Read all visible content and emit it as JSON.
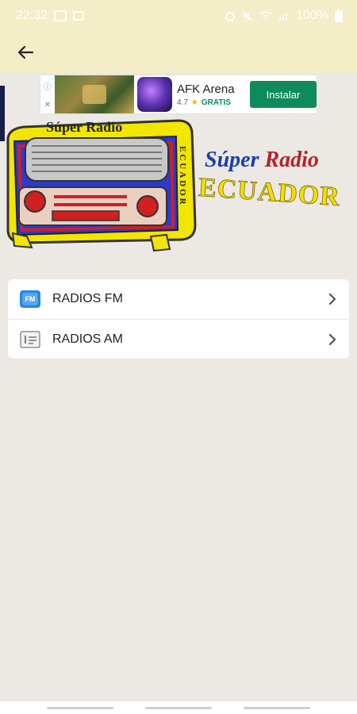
{
  "status_bar": {
    "time": "22:32",
    "battery": "100%",
    "icons": [
      "image-icon",
      "screen-icon",
      "alarm-icon",
      "mute-icon",
      "wifi-icon",
      "signal-icon",
      "battery-icon"
    ]
  },
  "app_bar": {
    "back_icon": "arrow-left-icon"
  },
  "ad": {
    "title": "AFK Arena",
    "rating": "4.7",
    "star": "★",
    "price": "GRATIS",
    "install_label": "Instalar",
    "info_icon": "ⓘ",
    "close_icon": "✕"
  },
  "logo": {
    "radio_label": "Súper Radio",
    "radio_side": "ECUADOR",
    "title_word_1": "Súper",
    "title_word_2": "Radio",
    "title_word_3": "ECUADOR"
  },
  "menu": {
    "items": [
      {
        "label": "RADIOS FM",
        "icon": "fm-radio-icon"
      },
      {
        "label": "RADIOS AM",
        "icon": "am-radio-icon"
      }
    ]
  },
  "colors": {
    "bar_bg": "#f3edc8",
    "install_green": "#0f8a5a",
    "logo_blue": "#1b3ea8",
    "logo_red": "#b8202a",
    "logo_yellow": "#f5e000"
  }
}
